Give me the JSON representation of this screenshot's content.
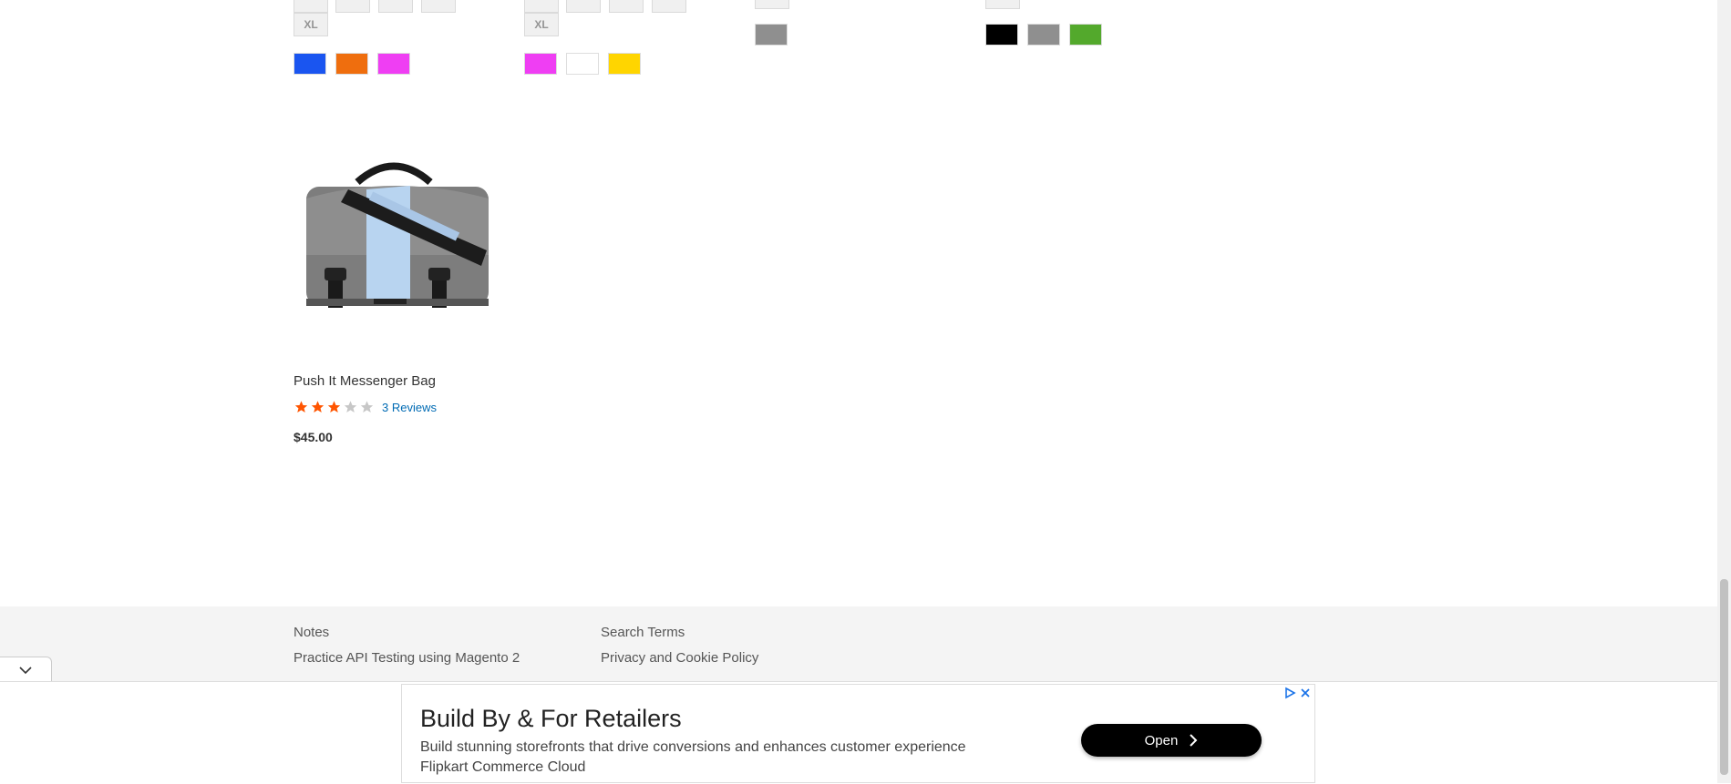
{
  "swatch_rows": {
    "size_label": "XL",
    "colors_col1": [
      "#1a55f0",
      "#ef6e0e",
      "#ef3ef3"
    ],
    "colors_col2": [
      "#ef3ef3",
      "#ffffff",
      "#ffd500"
    ],
    "colors_col3": [
      "#8f8f8f"
    ],
    "colors_col4": [
      "#000000",
      "#8f8f8f",
      "#53a92c"
    ]
  },
  "product": {
    "name": "Push It Messenger Bag",
    "rating_fraction": 0.6,
    "reviews_label": "3 Reviews",
    "price": "$45.00"
  },
  "footer": {
    "col1": [
      "Notes",
      "Practice API Testing using Magento 2"
    ],
    "col2": [
      "Search Terms",
      "Privacy and Cookie Policy"
    ]
  },
  "ad": {
    "title": "Build By & For Retailers",
    "description": "Build stunning storefronts that drive conversions and enhances customer experience",
    "brand": "Flipkart Commerce Cloud",
    "open_label": "Open"
  },
  "icons": {
    "collapse": "chevron-down-icon",
    "ad_info": "adchoices-icon",
    "ad_close": "close-icon",
    "open_arrow": "chevron-right-icon"
  }
}
